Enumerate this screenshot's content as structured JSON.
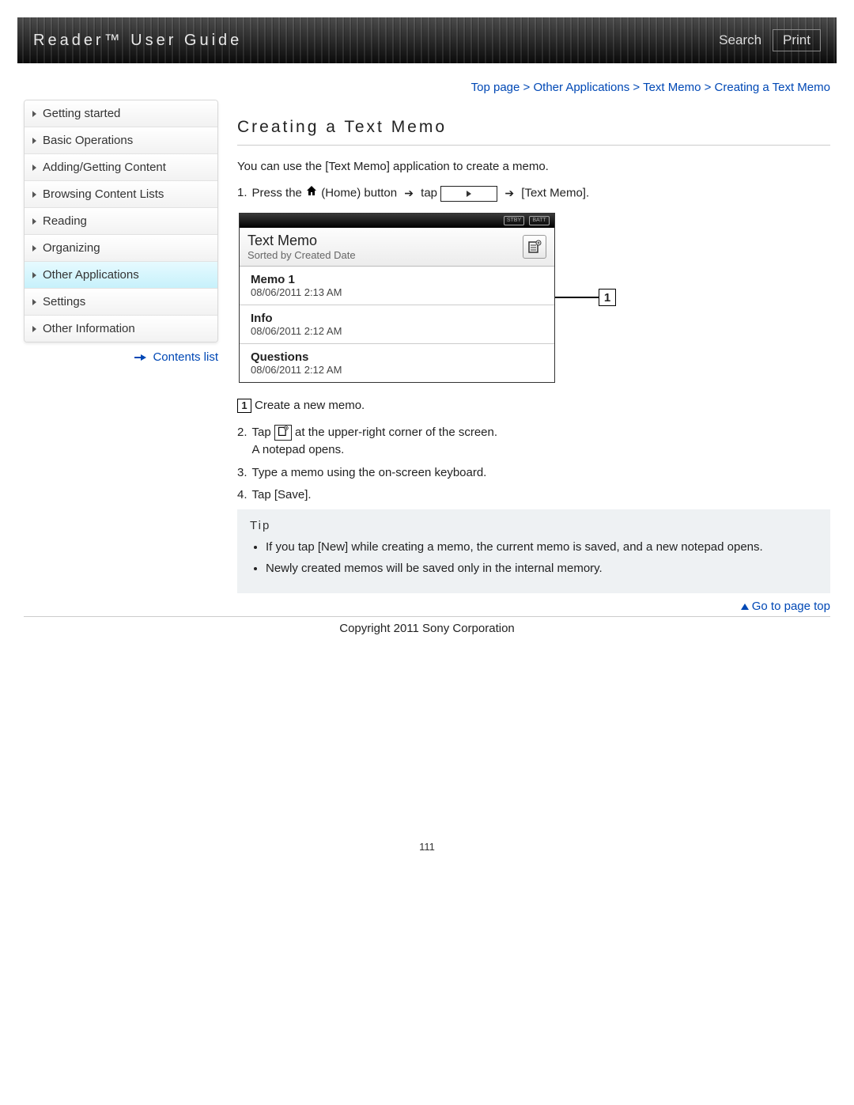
{
  "header": {
    "title": "Reader™ User Guide",
    "search_label": "Search",
    "print_label": "Print"
  },
  "sidebar": {
    "items": [
      {
        "label": "Getting started",
        "active": false
      },
      {
        "label": "Basic Operations",
        "active": false
      },
      {
        "label": "Adding/Getting Content",
        "active": false
      },
      {
        "label": "Browsing Content Lists",
        "active": false
      },
      {
        "label": "Reading",
        "active": false
      },
      {
        "label": "Organizing",
        "active": false
      },
      {
        "label": "Other Applications",
        "active": true
      },
      {
        "label": "Settings",
        "active": false
      },
      {
        "label": "Other Information",
        "active": false
      }
    ],
    "contents_list_label": "Contents list"
  },
  "breadcrumb": {
    "parts": [
      "Top page",
      "Other Applications",
      "Text Memo",
      "Creating a Text Memo"
    ],
    "separator": " > "
  },
  "article": {
    "title": "Creating a Text Memo",
    "intro": "You can use the [Text Memo] application to create a memo.",
    "step1_prefix": "1.",
    "step1_a": "Press the ",
    "step1_home": "(Home) button",
    "step1_tap": " tap ",
    "step1_target": " [Text Memo].",
    "callout1": "1",
    "callout1_text": "Create a new memo.",
    "step2_prefix": "2.",
    "step2_a": "Tap ",
    "step2_b": " at the upper-right corner of the screen.",
    "step2_c": "A notepad opens.",
    "step3_prefix": "3.",
    "step3": "Type a memo using the on-screen keyboard.",
    "step4_prefix": "4.",
    "step4": "Tap [Save]."
  },
  "screenshot": {
    "title": "Text Memo",
    "subtitle": "Sorted by Created Date",
    "new_icon_name": "new-memo-icon",
    "status_badges": [
      "STBY",
      "BATT"
    ],
    "rows": [
      {
        "name": "Memo 1",
        "date": "08/06/2011 2:13 AM"
      },
      {
        "name": "Info",
        "date": "08/06/2011 2:12 AM"
      },
      {
        "name": "Questions",
        "date": "08/06/2011 2:12 AM"
      }
    ],
    "callout_label": "1"
  },
  "tip": {
    "heading": "Tip",
    "items": [
      "If you tap [New] while creating a memo, the current memo is saved, and a new notepad opens.",
      "Newly created memos will be saved only in the internal memory."
    ]
  },
  "footer": {
    "gotop": "Go to page top",
    "copyright": "Copyright 2011 Sony Corporation",
    "page_number": "111"
  }
}
